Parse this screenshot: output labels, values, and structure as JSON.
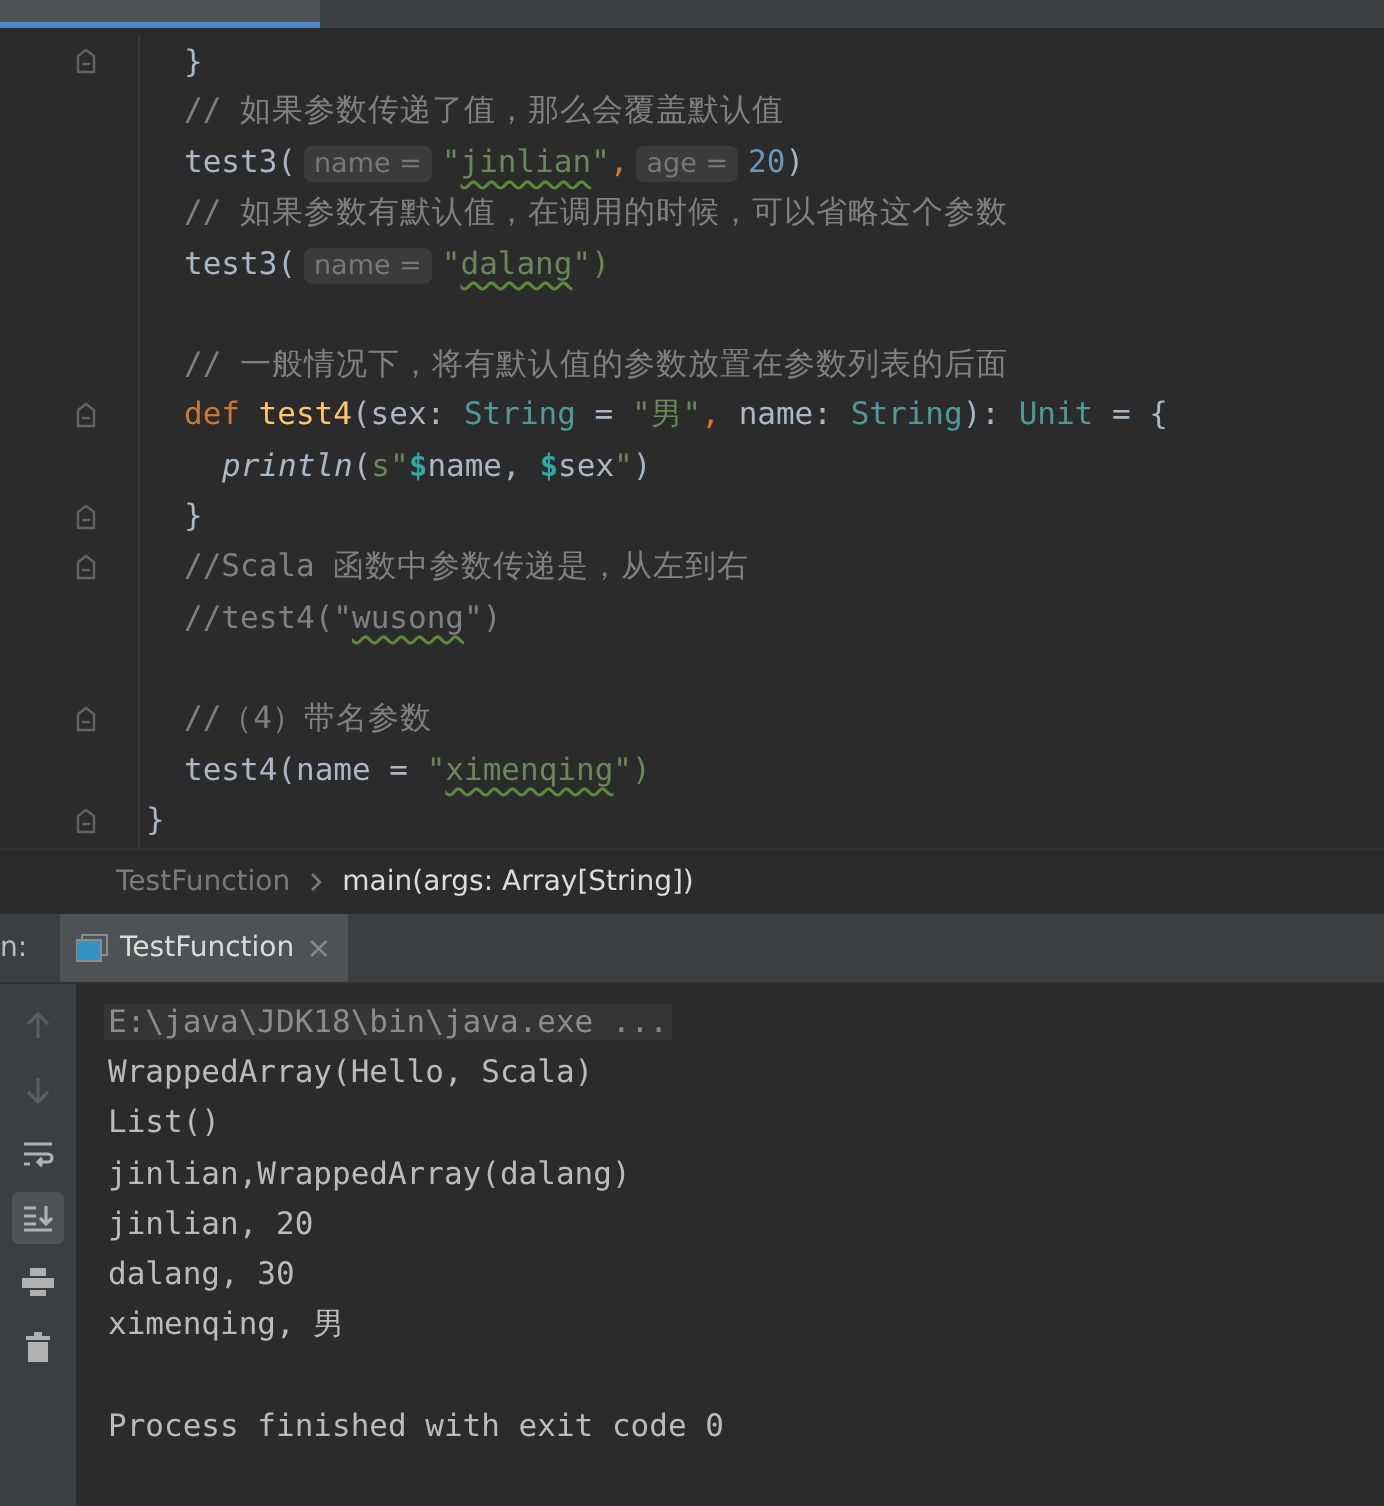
{
  "editor": {
    "lines": [
      {
        "kind": "block",
        "children": [
          {
            "kind": "code",
            "fold": true,
            "tokens": [
              {
                "text": "}",
                "kind": "plain"
              }
            ]
          },
          {
            "kind": "code",
            "fold": false,
            "tokens": [
              {
                "text": "// 如果参数传递了值，那么会覆盖默认值",
                "kind": "comment"
              }
            ]
          },
          {
            "kind": "code",
            "fold": false,
            "tokens": [
              {
                "text": "test3(",
                "kind": "plain"
              },
              {
                "text": "name =",
                "kind": "hint"
              },
              {
                "text": "\"",
                "kind": "string"
              },
              {
                "text": "jinlian",
                "kind": "string",
                "typo": true
              },
              {
                "text": "\"",
                "kind": "string"
              },
              {
                "text": ",",
                "kind": "punct"
              },
              {
                "text": "age =",
                "kind": "hint"
              },
              {
                "text": "20",
                "kind": "number"
              },
              {
                "text": ")",
                "kind": "plain"
              }
            ]
          },
          {
            "kind": "code",
            "fold": false,
            "tokens": [
              {
                "text": "// 如果参数有默认值，在调用的时候，可以省略这个参数",
                "kind": "comment"
              }
            ]
          },
          {
            "kind": "code",
            "fold": false,
            "tokens": [
              {
                "text": "test3(",
                "kind": "plain"
              },
              {
                "text": "name =",
                "kind": "hint"
              },
              {
                "text": "\"",
                "kind": "string"
              },
              {
                "text": "dalang",
                "kind": "string",
                "typo": true
              },
              {
                "text": "\")",
                "kind": "string"
              }
            ]
          },
          {
            "kind": "blank",
            "fold": false
          },
          {
            "kind": "code",
            "fold": false,
            "tokens": [
              {
                "text": "// 一般情况下，将有默认值的参数放置在参数列表的后面",
                "kind": "comment"
              }
            ]
          },
          {
            "kind": "code",
            "fold": true,
            "tokens": [
              {
                "text": "def",
                "kind": "keyword"
              },
              {
                "text": "test4",
                "kind": "function"
              },
              {
                "text": "(sex: ",
                "kind": "plain"
              },
              {
                "text": "String",
                "kind": "type"
              },
              {
                "text": " = ",
                "kind": "plain"
              },
              {
                "text": "\"男\"",
                "kind": "string"
              },
              {
                "text": ",",
                "kind": "punct"
              },
              {
                "text": " name: ",
                "kind": "plain"
              },
              {
                "text": "String",
                "kind": "type"
              },
              {
                "text": "): ",
                "kind": "plain"
              },
              {
                "text": "Unit",
                "kind": "type"
              },
              {
                "text": " = {",
                "kind": "plain"
              }
            ],
            "children": [
              {
                "kind": "code",
                "fold": false,
                "tokens": [
                  {
                    "text": "println",
                    "kind": "call"
                  },
                  {
                    "text": "(",
                    "kind": "plain"
                  },
                  {
                    "text": "s\"",
                    "kind": "string"
                  },
                  {
                    "text": "$",
                    "kind": "interp"
                  },
                  {
                    "text": "name, ",
                    "kind": "plain"
                  },
                  {
                    "text": "$",
                    "kind": "interp"
                  },
                  {
                    "text": "sex",
                    "kind": "plain"
                  },
                  {
                    "text": "\"",
                    "kind": "string"
                  },
                  {
                    "text": ")",
                    "kind": "plain"
                  }
                ]
              }
            ]
          },
          {
            "kind": "code",
            "fold": true,
            "tokens": [
              {
                "text": "}",
                "kind": "plain"
              }
            ]
          },
          {
            "kind": "code",
            "fold": true,
            "tokens": [
              {
                "text": "//Scala 函数中参数传递是，从左到右",
                "kind": "comment"
              }
            ]
          },
          {
            "kind": "code",
            "fold": false,
            "tokens": [
              {
                "text": "//test4(\"",
                "kind": "comment"
              },
              {
                "text": "wusong",
                "kind": "comment",
                "typo": true
              },
              {
                "text": "\")",
                "kind": "comment"
              }
            ]
          },
          {
            "kind": "blank",
            "fold": false
          },
          {
            "kind": "code",
            "fold": true,
            "tokens": [
              {
                "text": "//（4）带名参数",
                "kind": "comment"
              }
            ]
          },
          {
            "kind": "code",
            "fold": false,
            "tokens": [
              {
                "text": "test4(name = ",
                "kind": "plain"
              },
              {
                "text": "\"",
                "kind": "string"
              },
              {
                "text": "ximenqing",
                "kind": "string",
                "typo": true
              },
              {
                "text": "\")",
                "kind": "string"
              }
            ]
          }
        ]
      },
      {
        "kind": "code",
        "fold": true,
        "tokens": [
          {
            "text": "}",
            "kind": "plain"
          }
        ]
      }
    ]
  },
  "breadcrumb": [
    {
      "label": "TestFunction",
      "selected": false
    },
    {
      "label": "main(args: Array[String])",
      "selected": true
    }
  ],
  "run_panel": {
    "label": "n:",
    "tabs": [
      {
        "label": "TestFunction",
        "close": "×",
        "selected": true
      }
    ]
  },
  "console": {
    "toolbar": [
      {
        "kind": "up",
        "disabled": true,
        "selected": false
      },
      {
        "kind": "down",
        "disabled": true,
        "selected": false
      },
      {
        "kind": "wrap",
        "disabled": false,
        "selected": false
      },
      {
        "kind": "scroll-end",
        "disabled": false,
        "selected": true
      },
      {
        "kind": "print",
        "disabled": false,
        "selected": false
      },
      {
        "kind": "trash",
        "disabled": false,
        "selected": false
      }
    ],
    "lines": [
      {
        "kind": "command",
        "text": "E:\\java\\JDK18\\bin\\java.exe ..."
      },
      {
        "kind": "output",
        "text": "WrappedArray(Hello, Scala)"
      },
      {
        "kind": "output",
        "text": "List()"
      },
      {
        "kind": "output",
        "text": "jinlian,WrappedArray(dalang)"
      },
      {
        "kind": "output",
        "text": "jinlian, 20"
      },
      {
        "kind": "output",
        "text": "dalang, 30"
      },
      {
        "kind": "output",
        "text": "ximenqing, 男"
      },
      {
        "kind": "blank"
      },
      {
        "kind": "output",
        "text": "Process finished with exit code 0"
      }
    ]
  }
}
